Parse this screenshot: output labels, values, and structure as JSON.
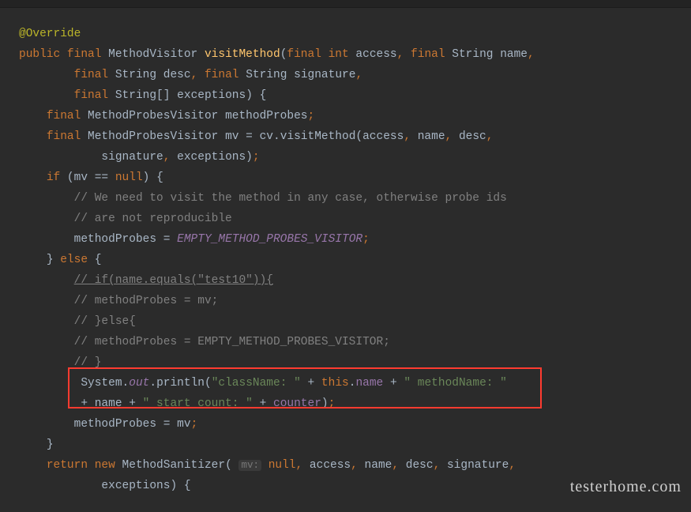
{
  "watermark": "testerhome.com",
  "code": {
    "annotation": "@Override",
    "kw_public": "public",
    "kw_final": "final",
    "kw_int": "int",
    "kw_if": "if",
    "kw_else": "else",
    "kw_null": "null",
    "kw_return": "return",
    "kw_new": "new",
    "kw_this": "this",
    "type_MethodVisitor": "MethodVisitor",
    "type_String": "String",
    "type_StringArr": "String[]",
    "type_MethodProbesVisitor": "MethodProbesVisitor",
    "type_MethodSanitizer": "MethodSanitizer",
    "fn_visitMethod": "visitMethod",
    "fn_println": "println",
    "id_access": "access",
    "id_name": "name",
    "id_desc": "desc",
    "id_signature": "signature",
    "id_exceptions": "exceptions",
    "id_methodProbes": "methodProbes",
    "id_mv": "mv",
    "id_cv": "cv",
    "id_System": "System",
    "id_counter": "counter",
    "field_out": "out",
    "const_empty": "EMPTY_METHOD_PROBES_VISITOR",
    "cmt_need1": "// We need to visit the method in any case, otherwise probe ids",
    "cmt_need2": "// are not reproducible",
    "cmt_if_test10": "// if(name.equals(\"test10\")){",
    "cmt_mp_mv": "// methodProbes = mv;",
    "cmt_else": "// }else{",
    "cmt_mp_empty": "// methodProbes = EMPTY_METHOD_PROBES_VISITOR;",
    "cmt_endbrace": "// }",
    "str_className": "\"className: \"",
    "str_methodName": "\" methodName: \"",
    "str_startCount": "\" start count: \"",
    "hint_mv": "mv:",
    "op_eqeq": "==",
    "op_eq": "=",
    "op_plus": "+",
    "p_open": "(",
    "p_close": ")",
    "b_open": "{",
    "b_close": "}",
    "semi": ";",
    "comma": ",",
    "dot": "."
  }
}
